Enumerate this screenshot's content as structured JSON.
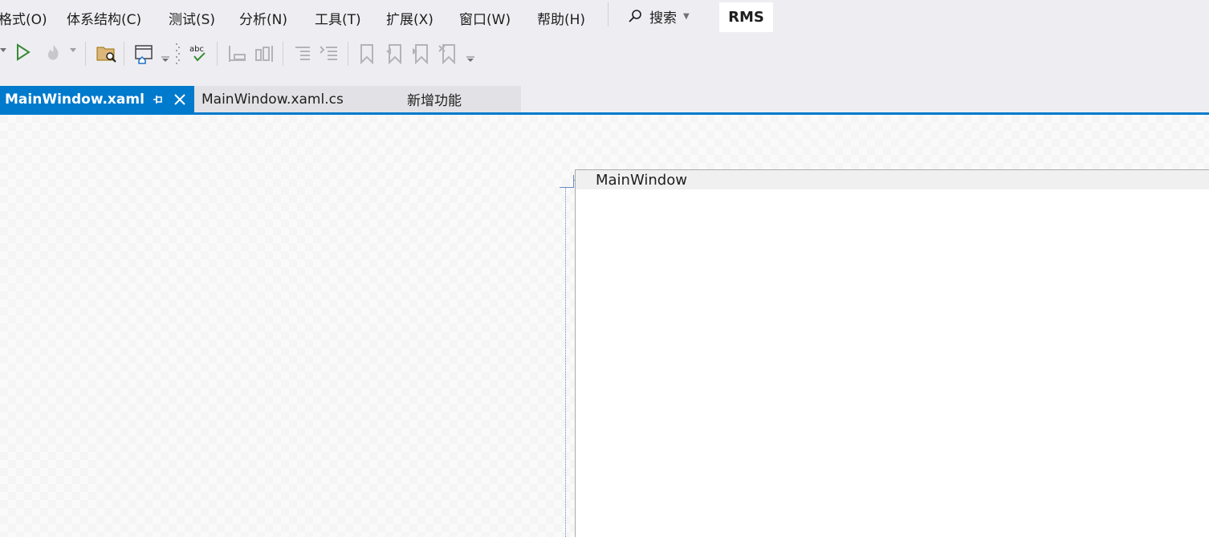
{
  "menu": {
    "items": [
      {
        "label": "格式(O)"
      },
      {
        "label": "体系结构(C)"
      },
      {
        "label": "测试(S)"
      },
      {
        "label": "分析(N)"
      },
      {
        "label": "工具(T)"
      },
      {
        "label": "扩展(X)"
      },
      {
        "label": "窗口(W)"
      },
      {
        "label": "帮助(H)"
      }
    ],
    "search_label": "搜索",
    "badge": "RMS"
  },
  "toolbar": {
    "icons": [
      "dropdown-arrow-icon",
      "start-debug-icon",
      "hot-reload-icon",
      "find-in-files-icon",
      "xaml-home-icon",
      "spell-check-icon",
      "format-left-icon",
      "format-right-icon",
      "comment-icon",
      "uncomment-icon",
      "bookmark-icon",
      "bookmark-prev-icon",
      "bookmark-next-icon",
      "bookmark-clear-icon"
    ]
  },
  "tabs": [
    {
      "label": "MainWindow.xaml"
    },
    {
      "label": "MainWindow.xaml.cs"
    },
    {
      "label": "新增功能"
    }
  ],
  "designer": {
    "window_title": "MainWindow"
  },
  "colors": {
    "accent": "#007acc",
    "chrome_bg": "#eeeef2",
    "run_green": "#388a34"
  }
}
